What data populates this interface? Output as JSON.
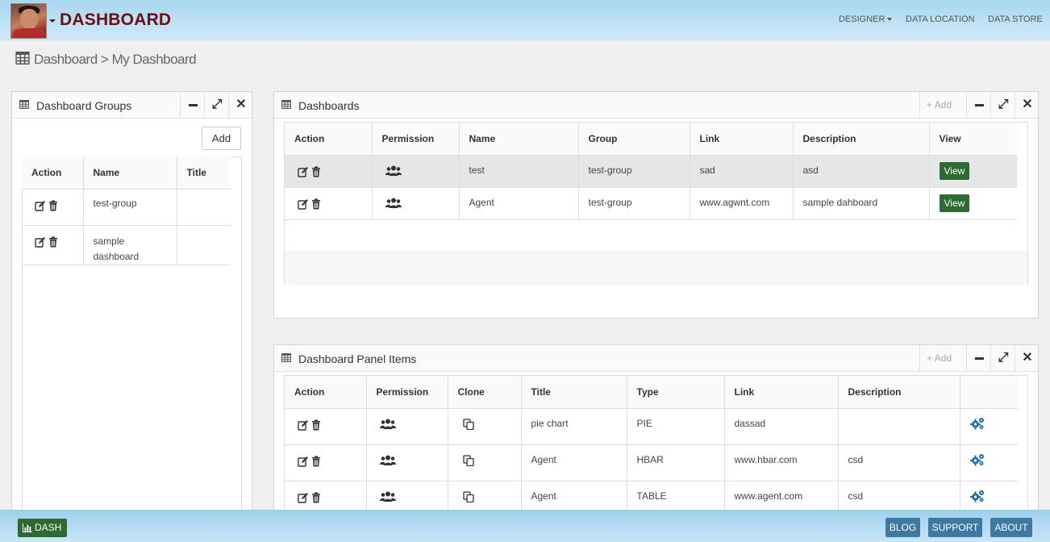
{
  "header": {
    "brand": "DASHBOARD",
    "nav": [
      "DESIGNER",
      "DATA LOCATION",
      "DATA STORE"
    ]
  },
  "breadcrumb": {
    "root": "Dashboard",
    "separator": ">",
    "current": "My Dashboard"
  },
  "groups_panel": {
    "title": "Dashboard Groups",
    "add_label": "Add",
    "columns": [
      "Action",
      "Name",
      "Title"
    ],
    "rows": [
      {
        "name": "test-group",
        "title": ""
      },
      {
        "name": "sample dashboard",
        "title": ""
      }
    ]
  },
  "dashboards_panel": {
    "title": "Dashboards",
    "add_label": "Add",
    "columns": [
      "Action",
      "Permission",
      "Name",
      "Group",
      "Link",
      "Description",
      "View"
    ],
    "view_label": "View",
    "rows": [
      {
        "name": "test",
        "group": "test-group",
        "link": "sad",
        "description": "asd"
      },
      {
        "name": "Agent",
        "group": "test-group",
        "link": "www.agwnt.com",
        "description": "sample dahboard"
      }
    ]
  },
  "items_panel": {
    "title": "Dashboard Panel Items",
    "add_label": "Add",
    "columns": [
      "Action",
      "Permission",
      "Clone",
      "Title",
      "Type",
      "Link",
      "Description",
      ""
    ],
    "rows": [
      {
        "title": "pie chart",
        "type": "PIE",
        "link": "dassad",
        "description": ""
      },
      {
        "title": "Agent",
        "type": "HBAR",
        "link": "www.hbar.com",
        "description": "csd"
      },
      {
        "title": "Agent",
        "type": "TABLE",
        "link": "www.agent.com",
        "description": "csd"
      }
    ]
  },
  "footer": {
    "dash_label": "DASH",
    "links": [
      "BLOG",
      "SUPPORT",
      "ABOUT"
    ]
  },
  "colors": {
    "brand": "#6a0f12",
    "view_button": "#2e6b32",
    "footer_button": "#3e79a3",
    "icon_blue": "#1f6fa8"
  }
}
